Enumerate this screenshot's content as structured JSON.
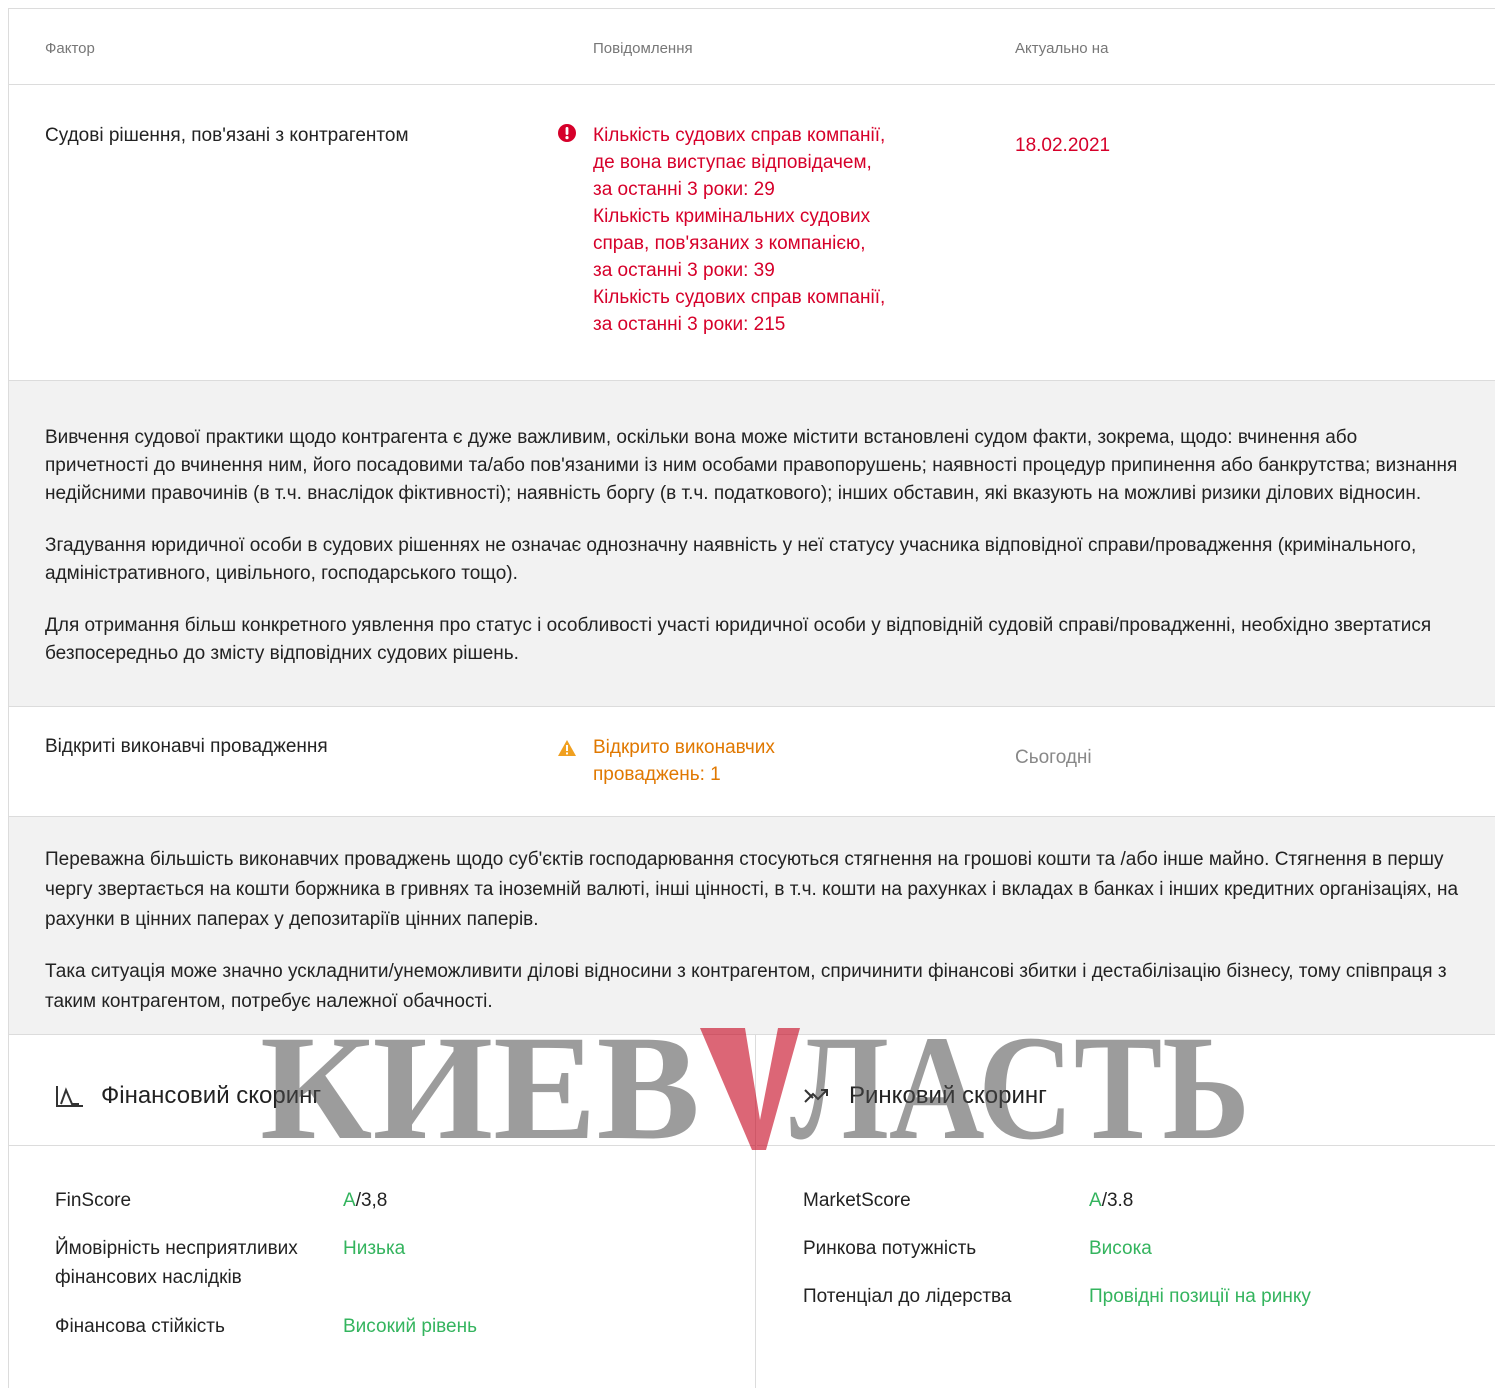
{
  "table": {
    "headers": {
      "factor": "Фактор",
      "message": "Повідомлення",
      "date": "Актуально на"
    },
    "rows": [
      {
        "factor": "Судові рішення, пов'язані з контрагентом",
        "message_lines": [
          "Кількість судових справ компанії,",
          "де вона виступає відповідачем,",
          "за останні 3 роки: 29",
          "Кількість кримінальних судових",
          "справ, пов'язаних з компанією,",
          "за останні 3 роки: 39",
          "Кількість судових справ компанії,",
          "за останні 3 роки: 215"
        ],
        "date": "18.02.2021",
        "severity": "error",
        "icon": "exclamation-circle-icon",
        "description": [
          "Вивчення судової практики щодо контрагента є дуже важливим, оскільки вона може містити встановлені судом факти, зокрема, щодо: вчинення або причетності до вчинення ним, його посадовими та/або пов'язаними із ним особами правопорушень; наявності процедур припинення або банкрутства; визнання недійсними правочинів (в т.ч. внаслідок фіктивності); наявність боргу (в т.ч. податкового); інших обставин, які вказують на можливі ризики ділових відносин.",
          "Згадування юридичної особи в судових рішеннях не означає однозначну наявність у неї статусу учасника відповідної справи/провадження (кримінального, адміністративного, цивільного, господарського тощо).",
          "Для отримання більш конкретного уявлення про статус і особливості участі юридичної особи у відповідній судовій справі/провадженні, необхідно звертатися безпосередньо до змісту відповідних судових рішень."
        ]
      },
      {
        "factor": "Відкриті виконавчі провадження",
        "message_lines": [
          "Відкрито виконавчих",
          "проваджень: 1"
        ],
        "date": "Сьогодні",
        "severity": "warning",
        "icon": "warning-triangle-icon",
        "description": [
          "Переважна більшість виконавчих проваджень щодо суб'єктів господарювання стосуються стягнення на грошові кошти та /або інше майно. Стягнення в першу чергу звертається на кошти боржника в гривнях та іноземній валюті, інші цінності, в т.ч. кошти на рахунках і вкладах в банках і інших кредитних організаціях, на рахунки в цінних паперах у депозитаріїв цінних паперів.",
          "Така ситуація може значно ускладнити/унеможливити ділові відносини з контрагентом, спричинити фінансові збитки і дестабілізацію бізнесу, тому співпраця з таким контрагентом, потребує належної обачності."
        ]
      }
    ]
  },
  "financial": {
    "title": "Фінансовий скоринг",
    "icon": "line-chart-icon",
    "items": [
      {
        "label": "FinScore",
        "grade": "A",
        "value": "/3,8"
      },
      {
        "label_lines": [
          "Ймовірність несприятливих",
          "фінансових наслідків"
        ],
        "value": "Низька"
      },
      {
        "label": "Фінансова стійкість",
        "value": "Високий рівень"
      }
    ]
  },
  "market": {
    "title": "Ринковий скоринг",
    "icon": "trend-arrows-icon",
    "items": [
      {
        "label": "MarketScore",
        "grade": "A",
        "value": "/3.8"
      },
      {
        "label": "Ринкова потужність",
        "value": "Висока"
      },
      {
        "label": "Потенціал до лідерства",
        "value": "Провідні позиції на ринку"
      }
    ]
  },
  "watermark": {
    "text": "КИЕВ",
    "accent": "V",
    "text2": "ЛАСТЬ"
  },
  "colors": {
    "error": "#d6002a",
    "warning": "#e07800",
    "positive": "#34b45e"
  }
}
